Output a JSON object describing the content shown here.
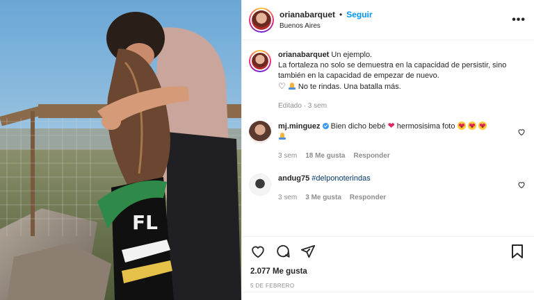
{
  "post": {
    "author": {
      "username": "orianabarquet",
      "dot": "•",
      "follow_label": "Seguir",
      "location": "Buenos Aires"
    },
    "more_icon": "more-horizontal-icon",
    "caption": {
      "username": "orianabarquet",
      "line1": "Un ejemplo.",
      "line2": "La fortaleza no solo se demuestra en la capacidad de persistir, sino también en la capacidad de empezar de nuevo.",
      "line3": "No te rindas. Una batalla más.",
      "time": "Editado · 3 sem"
    },
    "comments": [
      {
        "username": "mj.minguez",
        "text_before": "Bien dicho bebé",
        "text_after": "hermosisima foto",
        "time": "3 sem",
        "likes": "18 Me gusta",
        "reply": "Responder"
      },
      {
        "username": "andug75",
        "text": "#delponoterindas",
        "time": "3 sem",
        "likes": "3 Me gusta",
        "reply": "Responder"
      }
    ],
    "likes": "2.077 Me gusta",
    "date": "5 DE FEBRERO"
  },
  "colors": {
    "link": "#0095f6",
    "hashtag": "#00376b",
    "muted": "#8e8e8e",
    "text": "#262626"
  }
}
